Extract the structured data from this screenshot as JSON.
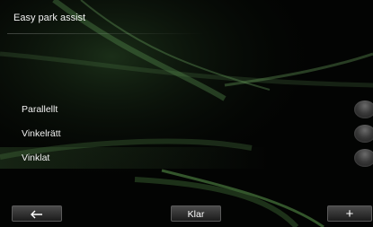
{
  "header": {
    "title": "Easy park assist"
  },
  "options": [
    {
      "label": "Parallellt"
    },
    {
      "label": "Vinkelrätt"
    },
    {
      "label": "Vinklat"
    }
  ],
  "footer": {
    "back_icon": "arrow-left-icon",
    "ok_label": "Klar",
    "plus_label": "+"
  }
}
